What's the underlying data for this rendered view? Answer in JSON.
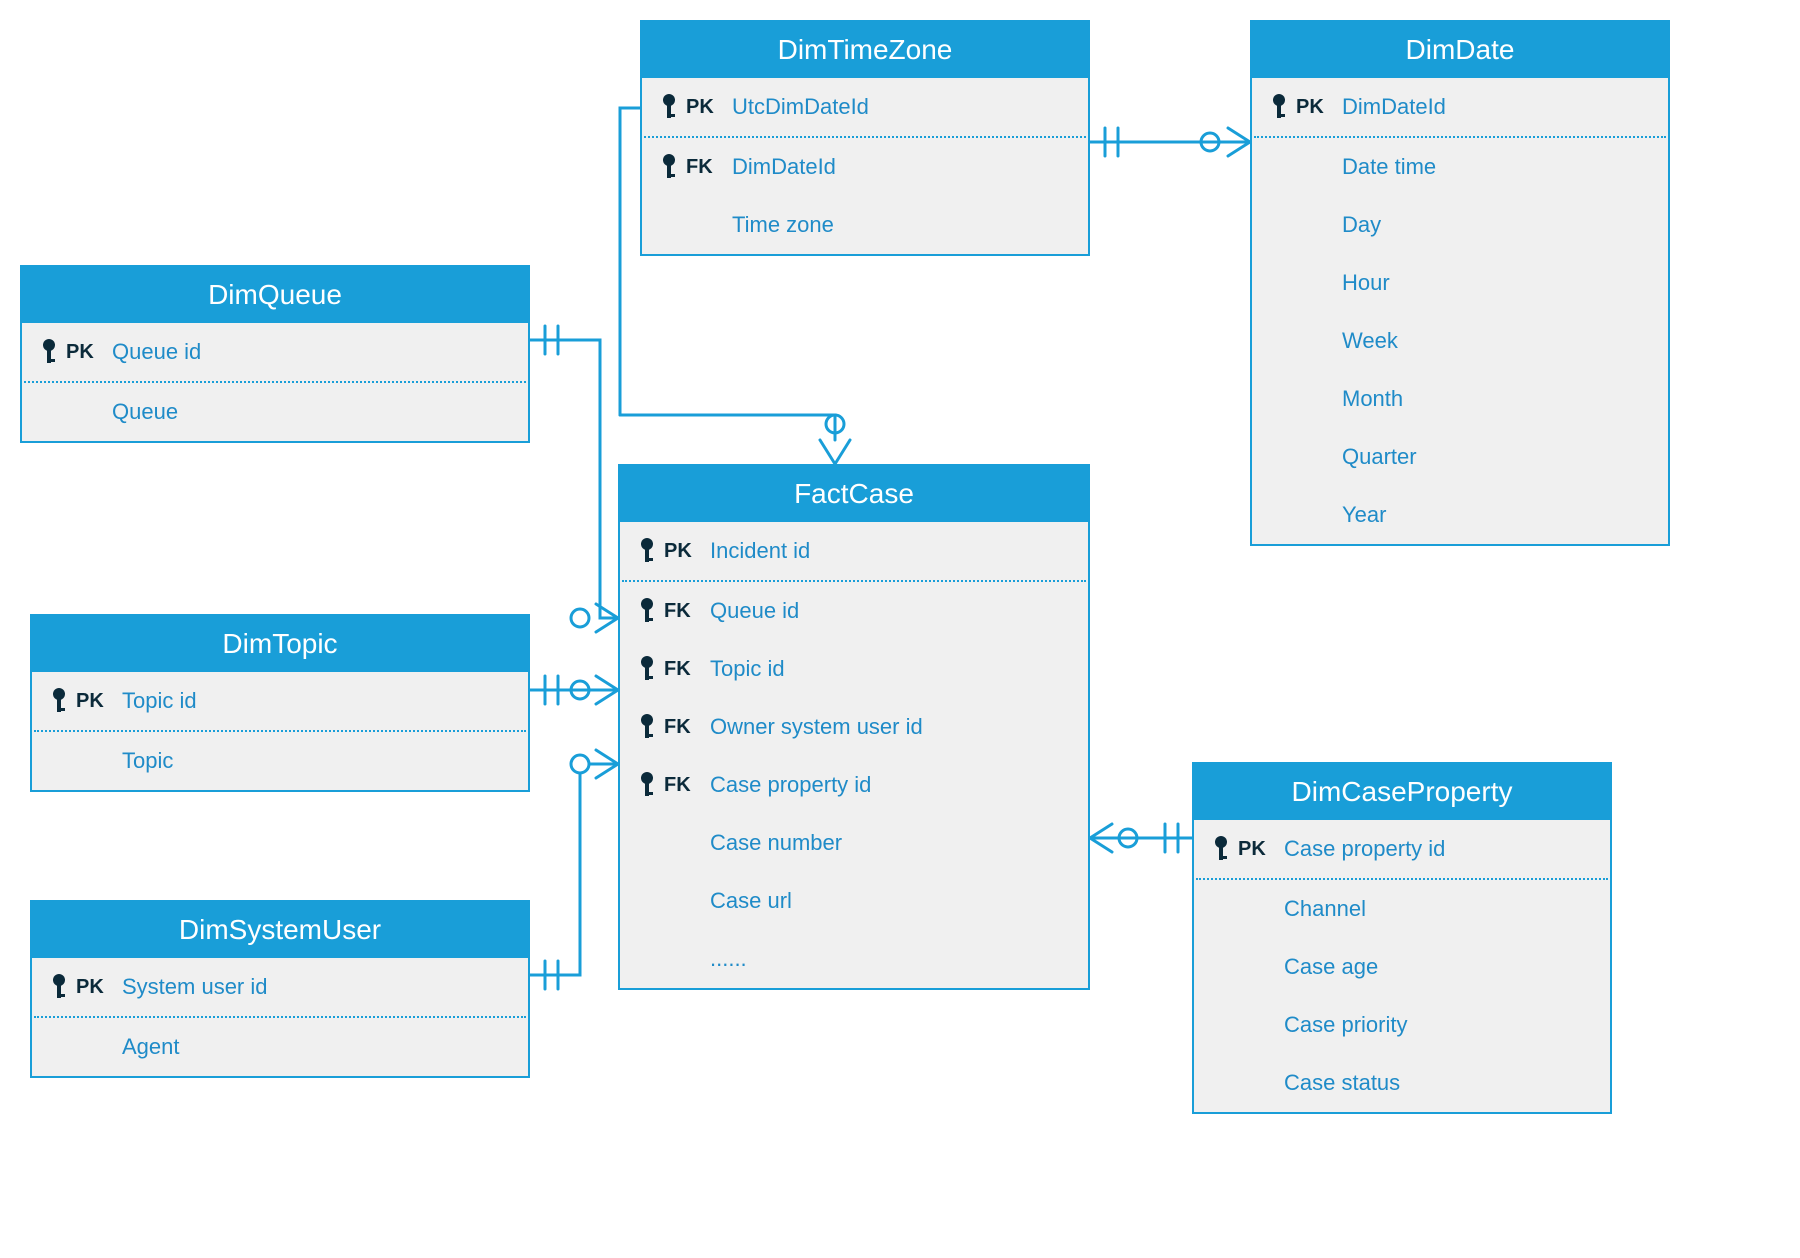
{
  "colors": {
    "accent": "#199ed8",
    "entity_bg": "#f0f0f0",
    "text_blue": "#1f8bc8",
    "key_dark": "#0b2a3a"
  },
  "entities": {
    "dimTimeZone": {
      "title": "DimTimeZone",
      "rows": [
        {
          "key": "PK",
          "name": "UtcDimDateId"
        },
        {
          "key": "FK",
          "name": "DimDateId"
        },
        {
          "key": "",
          "name": "Time zone"
        }
      ]
    },
    "dimDate": {
      "title": "DimDate",
      "rows": [
        {
          "key": "PK",
          "name": "DimDateId"
        },
        {
          "key": "",
          "name": "Date time"
        },
        {
          "key": "",
          "name": "Day"
        },
        {
          "key": "",
          "name": "Hour"
        },
        {
          "key": "",
          "name": "Week"
        },
        {
          "key": "",
          "name": "Month"
        },
        {
          "key": "",
          "name": "Quarter"
        },
        {
          "key": "",
          "name": "Year"
        }
      ]
    },
    "dimQueue": {
      "title": "DimQueue",
      "rows": [
        {
          "key": "PK",
          "name": "Queue id"
        },
        {
          "key": "",
          "name": "Queue"
        }
      ]
    },
    "dimTopic": {
      "title": "DimTopic",
      "rows": [
        {
          "key": "PK",
          "name": "Topic id"
        },
        {
          "key": "",
          "name": "Topic"
        }
      ]
    },
    "dimSystemUser": {
      "title": "DimSystemUser",
      "rows": [
        {
          "key": "PK",
          "name": "System user id"
        },
        {
          "key": "",
          "name": "Agent"
        }
      ]
    },
    "factCase": {
      "title": "FactCase",
      "rows": [
        {
          "key": "PK",
          "name": "Incident id"
        },
        {
          "key": "FK",
          "name": "Queue id"
        },
        {
          "key": "FK",
          "name": "Topic id"
        },
        {
          "key": "FK",
          "name": "Owner system user id"
        },
        {
          "key": "FK",
          "name": "Case property id"
        },
        {
          "key": "",
          "name": "Case number"
        },
        {
          "key": "",
          "name": "Case url"
        },
        {
          "key": "",
          "name": "......"
        }
      ]
    },
    "dimCaseProperty": {
      "title": "DimCaseProperty",
      "rows": [
        {
          "key": "PK",
          "name": "Case property id"
        },
        {
          "key": "",
          "name": "Channel"
        },
        {
          "key": "",
          "name": "Case age"
        },
        {
          "key": "",
          "name": "Case priority"
        },
        {
          "key": "",
          "name": "Case status"
        }
      ]
    }
  }
}
